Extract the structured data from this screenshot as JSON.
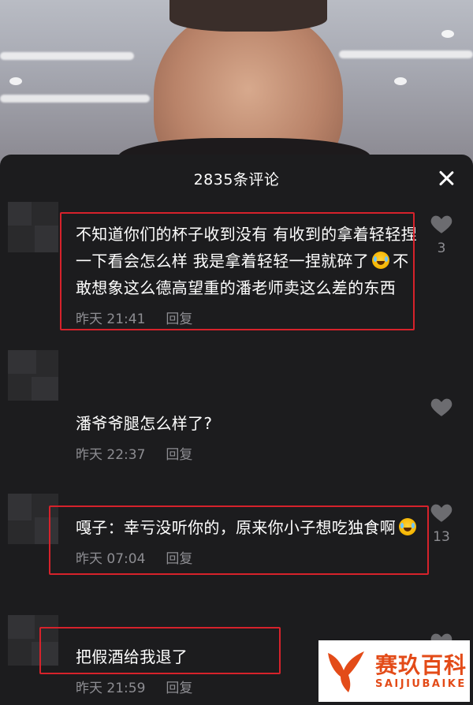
{
  "sheet": {
    "title": "2835条评论",
    "close_icon": "close-icon"
  },
  "comments": [
    {
      "text_part1": "不知道你们的杯子收到没有 有收到的拿着轻轻捏一下看会怎么样 我是拿着轻轻一捏就碎了",
      "text_part2": "不敢想象这么德高望重的潘老师卖这么差的东西",
      "has_emoji": true,
      "time": "昨天 21:41",
      "reply": "回复",
      "likes": "3",
      "highlighted": true
    },
    {
      "text_part1": "潘爷爷腿怎么样了?",
      "text_part2": "",
      "has_emoji": false,
      "time": "昨天 22:37",
      "reply": "回复",
      "likes": "",
      "highlighted": false
    },
    {
      "text_part1": "嘎子：幸亏没听你的，原来你小子想吃独食啊",
      "text_part2": "",
      "has_emoji": true,
      "time": "昨天 07:04",
      "reply": "回复",
      "likes": "13",
      "highlighted": true
    },
    {
      "text_part1": "把假酒给我退了",
      "text_part2": "",
      "has_emoji": false,
      "time": "昨天 21:59",
      "reply": "回复",
      "likes": "",
      "highlighted": true
    }
  ],
  "watermark": {
    "brand_cn": "赛玖百科",
    "brand_en": "SAIJIUBAIKE",
    "color": "#e34b18"
  },
  "colors": {
    "sheet_bg": "#1c1c1e",
    "highlight_border": "#d6222b",
    "meta_text": "#8d8d92"
  }
}
